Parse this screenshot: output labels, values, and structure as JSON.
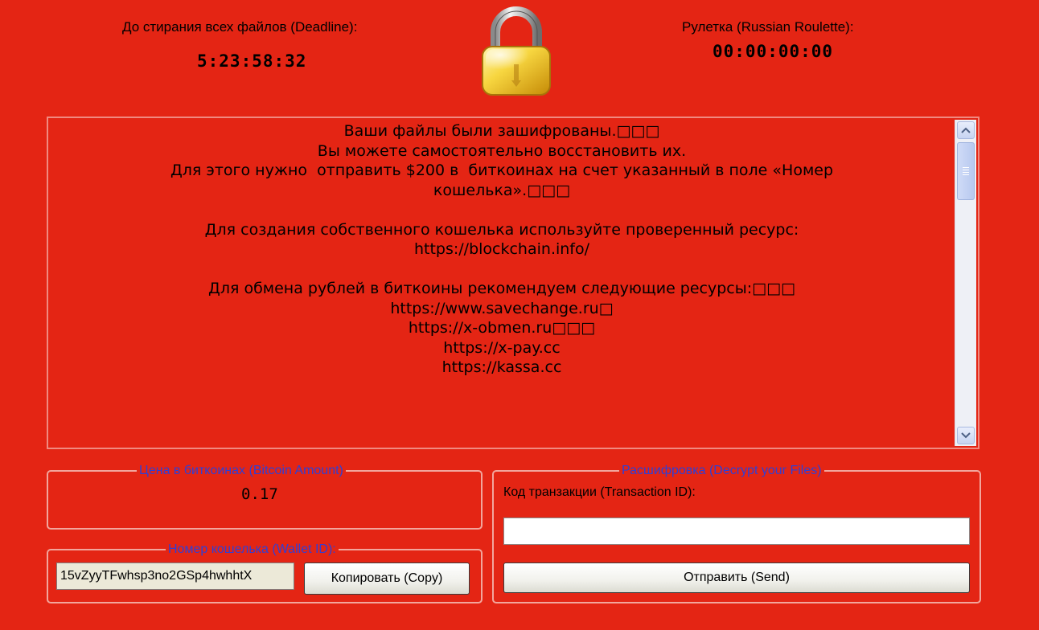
{
  "deadline": {
    "label": "До стирания всех файлов (Deadline):",
    "value": "5:23:58:32"
  },
  "roulette": {
    "label": "Рулетка (Russian Roulette):",
    "value": "00:00:00:00"
  },
  "lock_icon": "padlock-icon",
  "message": {
    "lines": [
      "Ваши файлы были зашифрованы.□□□",
      "Вы можете самостоятельно восстановить их.",
      "Для этого нужно  отправить $200 в  биткоинах на счет указанный в поле «Номер",
      "кошелька».□□□",
      "",
      "Для создания собственного кошелька используйте проверенный ресурс:",
      "https://blockchain.info/",
      "",
      "Для обмена рублей в биткоины рекомендуем следующие ресурсы:□□□",
      "https://www.savechange.ru□",
      "https://x-obmen.ru□□□",
      "https://x-pay.cc",
      "https://kassa.cc"
    ]
  },
  "bitcoin_amount": {
    "legend": "Цена в биткоинах (Bitcoin Amount)",
    "value": "0.17"
  },
  "wallet": {
    "legend": "Номер кошелька (Wallet ID):",
    "value": "15vZyyTFwhsp3no2GSp4hwhhtX",
    "copy_label": "Копировать (Copy)"
  },
  "decrypt": {
    "legend": "Расшифровка (Decrypt your Files)",
    "tx_label": "Код транзакции (Transaction ID):",
    "tx_value": "",
    "send_label": "Отправить (Send)"
  },
  "colors": {
    "background": "#e42514",
    "legend_text": "#2f3fd6",
    "group_border": "#f2a69d"
  }
}
